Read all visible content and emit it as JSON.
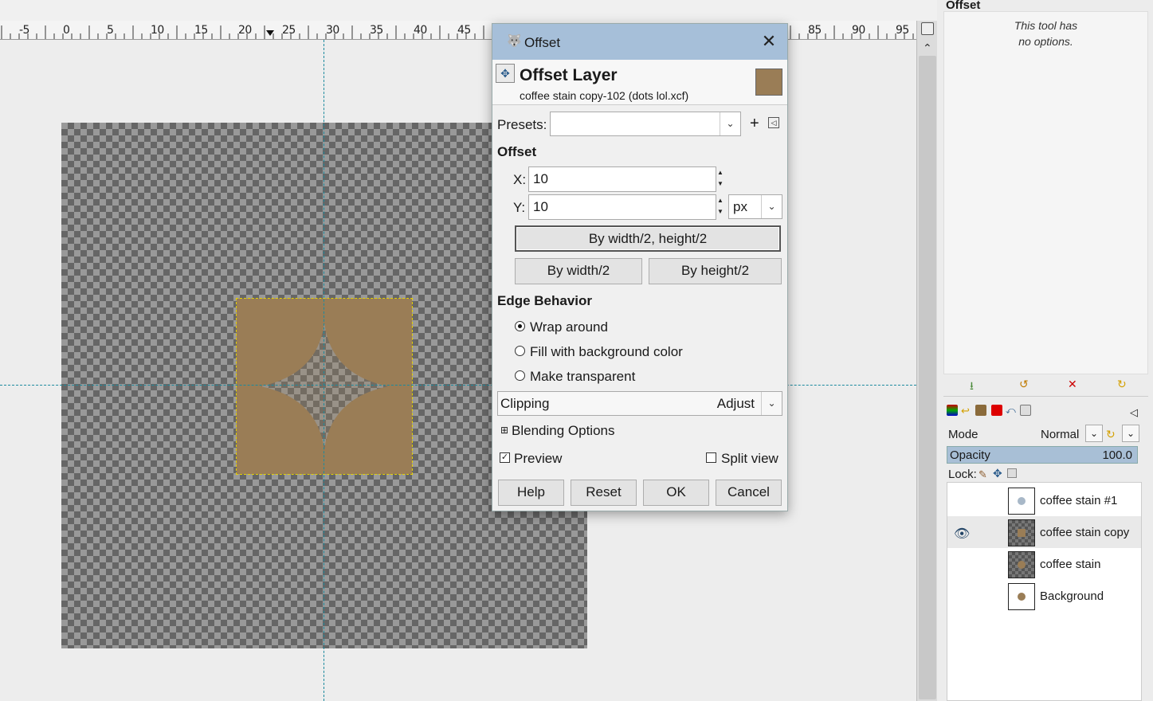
{
  "ruler": {
    "labels": [
      "-5",
      "0",
      "5",
      "10",
      "15",
      "20",
      "25",
      "30",
      "35",
      "40",
      "45",
      "85",
      "90",
      "95"
    ]
  },
  "canvas": {
    "layer_color": "#9a7d56"
  },
  "tool_options": {
    "title": "Offset",
    "message_line1": "This tool has",
    "message_line2": "no options."
  },
  "layers_panel": {
    "mode_label": "Mode",
    "mode_value": "Normal",
    "opacity_label": "Opacity",
    "opacity_value": "100.0",
    "lock_label": "Lock:",
    "layers": [
      {
        "name": "coffee stain #1",
        "visible": false
      },
      {
        "name": "coffee stain copy",
        "visible": true
      },
      {
        "name": "coffee stain",
        "visible": false
      },
      {
        "name": "Background",
        "visible": false
      }
    ]
  },
  "dialog": {
    "title": "Offset",
    "header_title": "Offset Layer",
    "header_subtitle": "coffee stain copy-102 (dots lol.xcf)",
    "presets_label": "Presets:",
    "presets_value": "",
    "offset_section": "Offset",
    "x_label": "X:",
    "x_value": "10",
    "y_label": "Y:",
    "y_value": "10",
    "unit": "px",
    "btn_both": "By width/2, height/2",
    "btn_width": "By width/2",
    "btn_height": "By height/2",
    "edge_section": "Edge Behavior",
    "edge_options": [
      "Wrap around",
      "Fill with background color",
      "Make transparent"
    ],
    "edge_selected": "Wrap around",
    "clipping_label": "Clipping",
    "clipping_value": "Adjust",
    "blending_label": "Blending Options",
    "preview_label": "Preview",
    "preview_checked": true,
    "split_label": "Split view",
    "split_checked": false,
    "help": "Help",
    "reset": "Reset",
    "ok": "OK",
    "cancel": "Cancel"
  }
}
